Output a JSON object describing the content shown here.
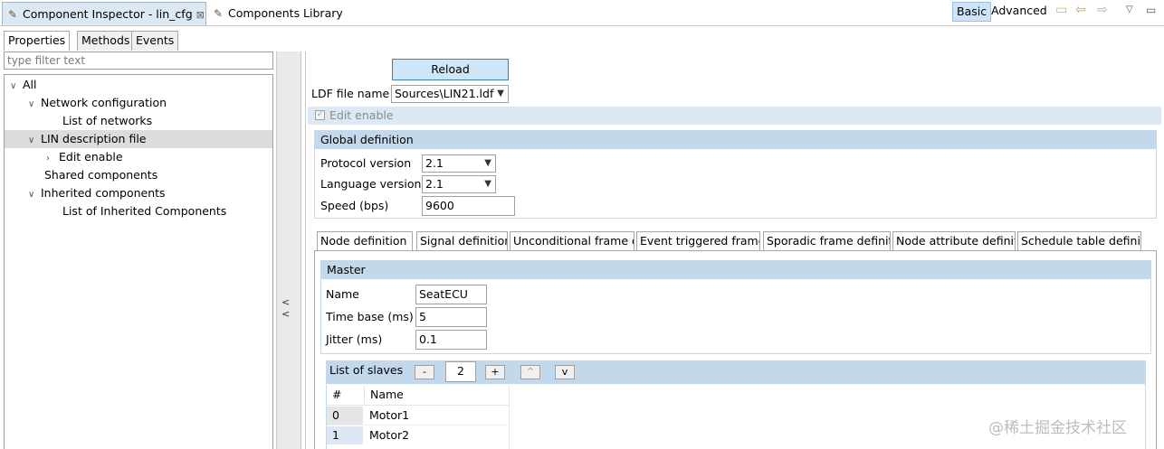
{
  "tabs": {
    "inspector": "Component Inspector - lin_cfg",
    "library": "Components Library",
    "close_glyph": "⊠"
  },
  "toolbar": {
    "basic": "Basic",
    "advanced": "Advanced"
  },
  "left": {
    "subtabs": [
      "Properties",
      "Methods",
      "Events"
    ],
    "filter_placeholder": "type filter text",
    "tree": {
      "all": "All",
      "network_configuration": "Network configuration",
      "list_of_networks": "List of networks",
      "lin_description_file": "LIN description file",
      "edit_enable": "Edit enable",
      "shared_components": "Shared components",
      "inherited_components": "Inherited components",
      "list_of_inherited": "List of Inherited Components"
    },
    "collapse_label": "< <"
  },
  "main": {
    "reload": "Reload",
    "ldf_label": "LDF file name",
    "ldf_value": "Sources\\LIN21.ldf",
    "edit_enable": "Edit enable",
    "global": {
      "title": "Global definition",
      "protocol_label": "Protocol version",
      "protocol_value": "2.1",
      "language_label": "Language version",
      "language_value": "2.1",
      "speed_label": "Speed (bps)",
      "speed_value": "9600"
    },
    "node_tabs": [
      "Node definition",
      "Signal definition",
      "Unconditional frame d",
      "Event triggered frame",
      "Sporadic frame definiti",
      "Node attribute definiti",
      "Schedule table definiti"
    ],
    "master": {
      "title": "Master",
      "name_label": "Name",
      "name_value": "SeatECU",
      "timebase_label": "Time base (ms)",
      "timebase_value": "5",
      "jitter_label": "Jitter (ms)",
      "jitter_value": "0.1"
    },
    "slaves": {
      "title": "List of slaves",
      "minus": "-",
      "count": "2",
      "plus": "+",
      "up": "^",
      "down": "v",
      "headers": [
        "#",
        "Name"
      ],
      "rows": [
        {
          "index": "0",
          "name": "Motor1"
        },
        {
          "index": "1",
          "name": "Motor2"
        }
      ]
    }
  },
  "watermark": "@稀土掘金技术社区",
  "colors": {
    "header_bar": "#c4d8ec",
    "active_tab": "#dde8f5",
    "reload_bg": "#cfe6f8"
  }
}
